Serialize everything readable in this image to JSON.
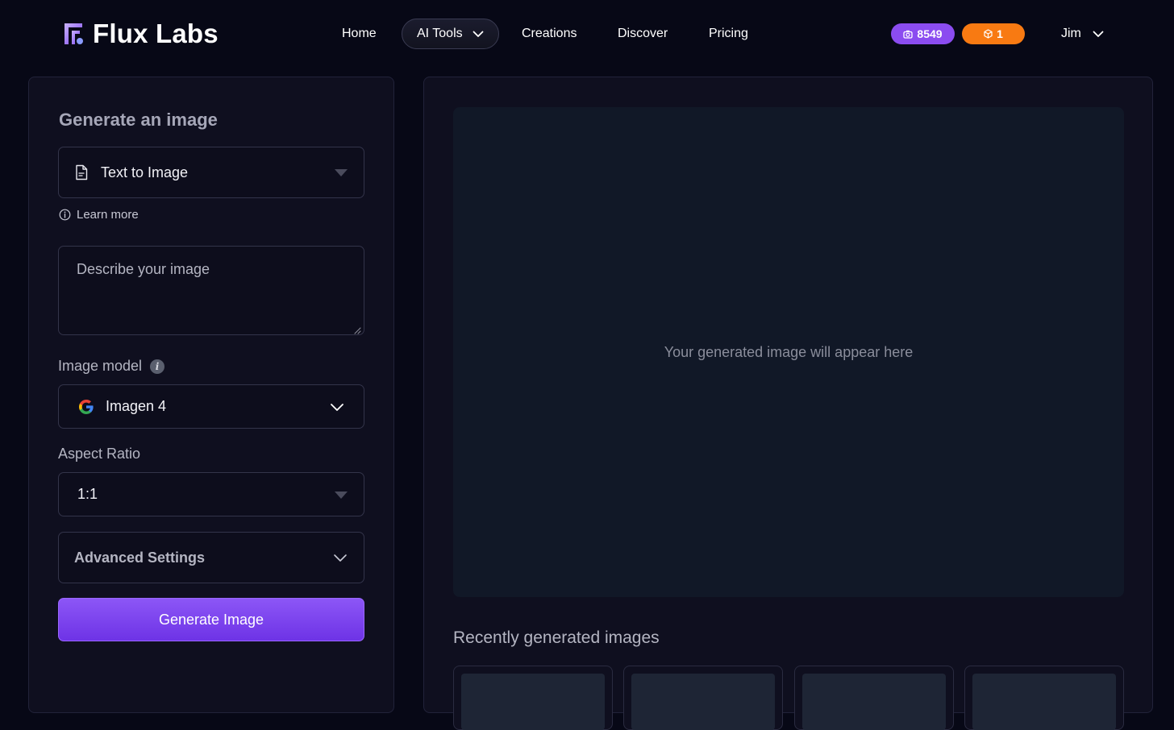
{
  "brand": {
    "name": "Flux Labs",
    "accent": "#8b4cf0"
  },
  "nav": {
    "items": [
      "Home",
      "AI Tools",
      "Creations",
      "Discover",
      "Pricing"
    ],
    "active_dropdown": "AI Tools"
  },
  "account": {
    "image_credits": "8549",
    "video_credits": "1",
    "user_name": "Jim"
  },
  "generator": {
    "title": "Generate an image",
    "mode": "Text to Image",
    "learn_more": "Learn more",
    "prompt_placeholder": "Describe your image",
    "model_label": "Image model",
    "model_value": "Imagen 4",
    "aspect_label": "Aspect Ratio",
    "aspect_value": "1:1",
    "advanced_label": "Advanced Settings",
    "generate_label": "Generate Image"
  },
  "preview": {
    "placeholder": "Your generated image will appear here",
    "recent_title": "Recently generated images"
  }
}
